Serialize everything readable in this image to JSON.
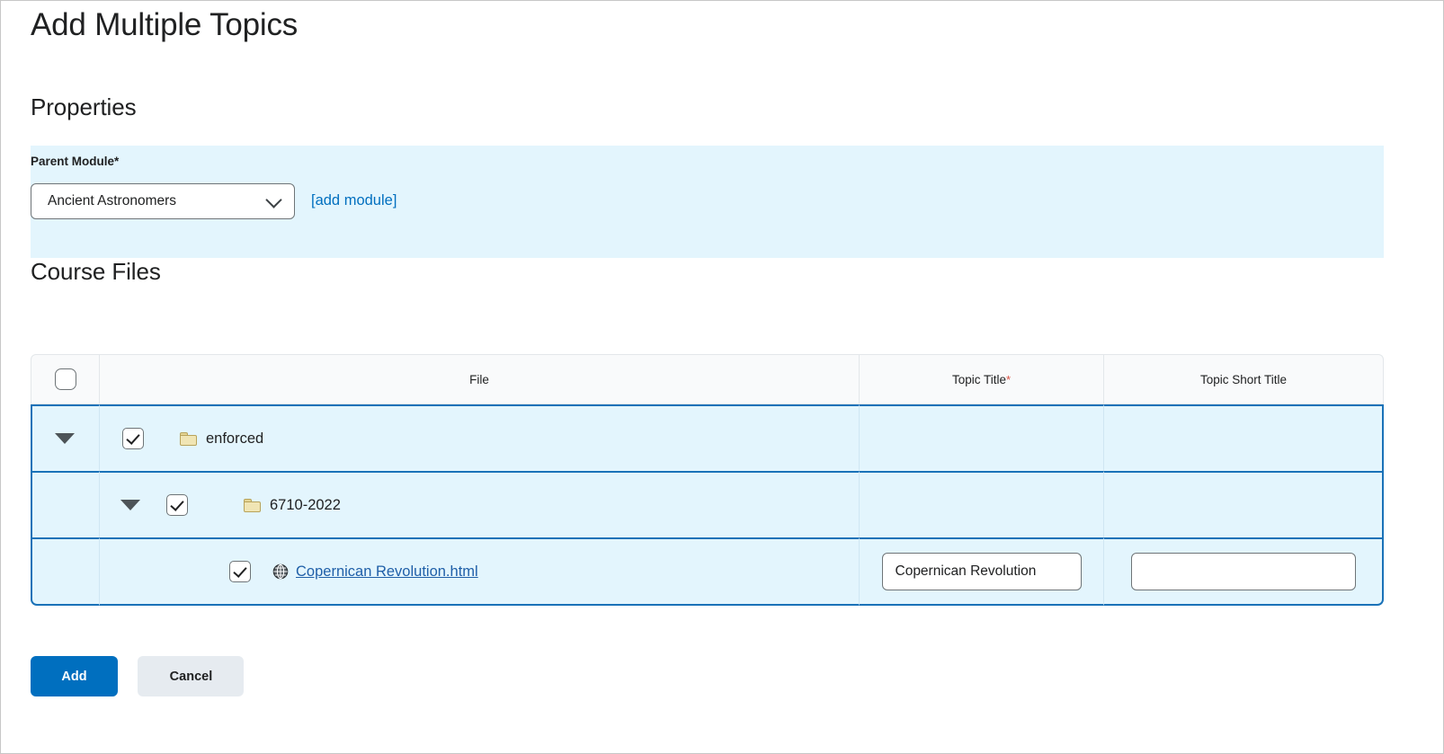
{
  "page": {
    "title": "Add Multiple Topics"
  },
  "sections": {
    "properties_heading": "Properties",
    "course_files_heading": "Course Files"
  },
  "properties": {
    "parent_module": {
      "label": "Parent Module",
      "required_marker": "*",
      "selected_value": "Ancient Astronomers",
      "chevron_icon": "chevron-down-icon"
    },
    "add_module_link": "[add module]"
  },
  "files_table": {
    "columns": [
      {
        "key": "select",
        "label": ""
      },
      {
        "key": "file",
        "label": "File"
      },
      {
        "key": "title",
        "label": "Topic Title",
        "required": true,
        "required_marker": "*"
      },
      {
        "key": "short",
        "label": "Topic Short Title"
      }
    ],
    "header_select_all": {
      "checked": false,
      "icon": "checkbox-icon"
    },
    "rows": [
      {
        "type": "folder",
        "depth": 0,
        "expanded": true,
        "caret_icon": "caret-down-icon",
        "checked": true,
        "icon": "folder-icon",
        "name": "enforced",
        "topic_title": "",
        "topic_short_title": ""
      },
      {
        "type": "folder",
        "depth": 1,
        "expanded": true,
        "caret_icon": "caret-down-icon",
        "checked": true,
        "icon": "folder-icon",
        "name": "6710-2022",
        "topic_title": "",
        "topic_short_title": ""
      },
      {
        "type": "file",
        "depth": 2,
        "expanded": false,
        "caret_icon": "",
        "checked": true,
        "icon": "globe-icon",
        "name": "Copernican Revolution.html",
        "topic_title": "Copernican Revolution",
        "topic_title_placeholder": "",
        "topic_short_title": "",
        "topic_short_title_placeholder": ""
      }
    ]
  },
  "actions": {
    "add_label": "Add",
    "cancel_label": "Cancel"
  },
  "colors": {
    "accent_blue": "#006fbf",
    "row_highlight": "#e3f5fd",
    "row_border": "#1a72b8",
    "link": "#1f5fa8",
    "required_star": "#d94f41",
    "folder": "#f0e5b4"
  }
}
